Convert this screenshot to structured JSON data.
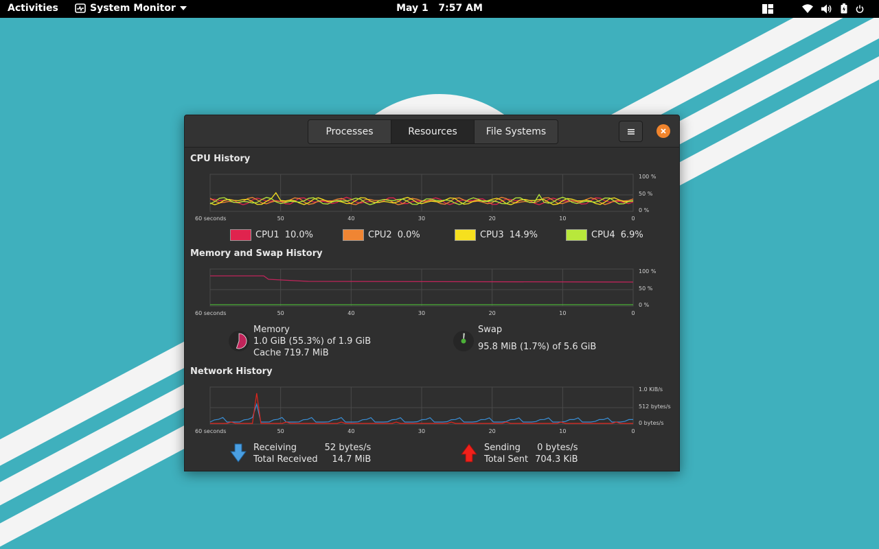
{
  "topbar": {
    "activities": "Activities",
    "app_name": "System Monitor",
    "date": "May 1",
    "time": "7:57 AM",
    "tray_icons": [
      "window-layout-icon",
      "wifi-icon",
      "volume-icon",
      "battery-icon",
      "power-icon"
    ]
  },
  "window": {
    "tabs": [
      "Processes",
      "Resources",
      "File Systems"
    ],
    "active_tab": "Resources",
    "menu_icon": "hamburger-menu-icon",
    "close_icon": "close-icon"
  },
  "cpu": {
    "title": "CPU History",
    "y_labels": [
      "100 %",
      "50 %",
      "0 %"
    ],
    "x_labels": [
      "60 seconds",
      "50",
      "40",
      "30",
      "20",
      "10",
      "0"
    ],
    "legend": [
      {
        "name": "CPU1",
        "value": "10.0%",
        "color": "#e0234e"
      },
      {
        "name": "CPU2",
        "value": "0.0%",
        "color": "#f08533"
      },
      {
        "name": "CPU3",
        "value": "14.9%",
        "color": "#f6e01e"
      },
      {
        "name": "CPU4",
        "value": "6.9%",
        "color": "#b8e83b"
      }
    ]
  },
  "memory": {
    "title": "Memory and Swap History",
    "y_labels": [
      "100 %",
      "50 %",
      "0 %"
    ],
    "x_labels": [
      "60 seconds",
      "50",
      "40",
      "30",
      "20",
      "10",
      "0"
    ],
    "memory_label": "Memory",
    "memory_usage": "1.0 GiB (55.3%) of 1.9 GiB",
    "memory_cache": "Cache 719.7 MiB",
    "memory_color": "#c0245a",
    "memory_fraction": 0.553,
    "swap_label": "Swap",
    "swap_usage": "95.8 MiB (1.7%) of 5.6 GiB",
    "swap_color": "#4cb038",
    "swap_fraction": 0.017
  },
  "network": {
    "title": "Network History",
    "y_labels": [
      "1.0 KiB/s",
      "512 bytes/s",
      "0 bytes/s"
    ],
    "x_labels": [
      "60 seconds",
      "50",
      "40",
      "30",
      "20",
      "10",
      "0"
    ],
    "receiving_label": "Receiving",
    "receiving_value": "52 bytes/s",
    "total_received_label": "Total Received",
    "total_received_value": "14.7 MiB",
    "sending_label": "Sending",
    "sending_value": "0 bytes/s",
    "total_sent_label": "Total Sent",
    "total_sent_value": "704.3 KiB",
    "receive_color": "#3a8fd6",
    "send_color": "#e0251c"
  }
}
